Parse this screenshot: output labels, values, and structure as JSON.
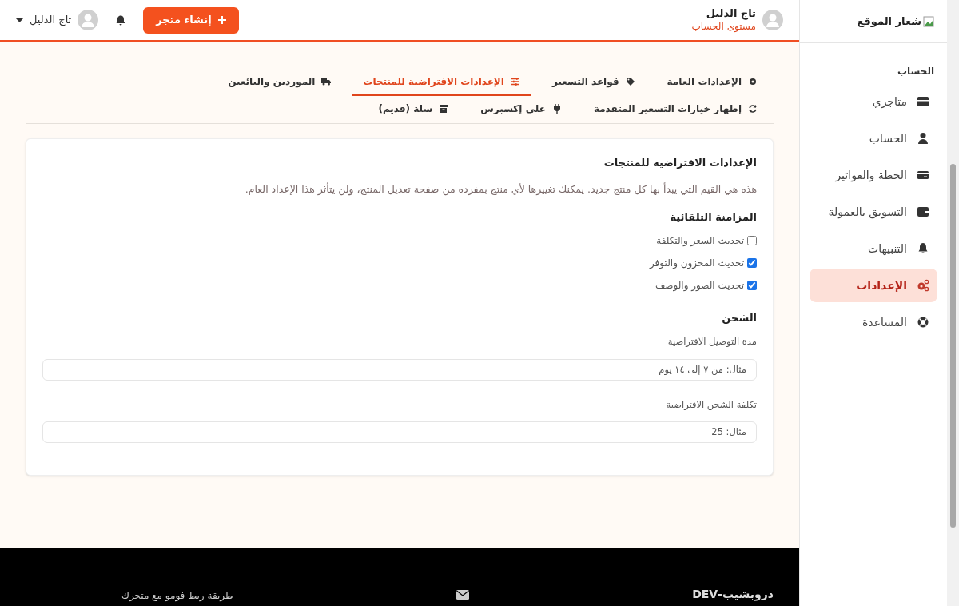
{
  "header": {
    "user_name": "تاج الدليل",
    "account_level": "مستوى الحساب",
    "create_button": "إنشاء متجر",
    "user_menu": "تاج الدليل"
  },
  "sidebar": {
    "logo": "شعار الموقع",
    "section": "الحساب",
    "items": [
      {
        "label": "متاجري",
        "selected": false
      },
      {
        "label": "الحساب",
        "selected": false
      },
      {
        "label": "الخطة والفواتير",
        "selected": false
      },
      {
        "label": "التسويق بالعمولة",
        "selected": false
      },
      {
        "label": "التنبيهات",
        "selected": false
      },
      {
        "label": "الإعدادات",
        "selected": true
      },
      {
        "label": "المساعدة",
        "selected": false
      }
    ]
  },
  "tabs": [
    {
      "label": "الإعدادات العامة",
      "selected": false
    },
    {
      "label": "قواعد التسعير",
      "selected": false
    },
    {
      "label": "الإعدادات الافتراضية للمنتجات",
      "selected": true
    },
    {
      "label": "الموردين والبائعين",
      "selected": false
    },
    {
      "label": "إظهار خيارات التسعير المتقدمة",
      "selected": false
    },
    {
      "label": "علي إكسبرس",
      "selected": false
    },
    {
      "label": "سلة (قديم)",
      "selected": false
    }
  ],
  "card": {
    "title": "الإعدادات الافتراضية للمنتجات",
    "description": "هذه هي القيم التي يبدأ بها كل منتج جديد. يمكنك تغييرها لأي منتج بمفرده من صفحة تعديل المنتج، ولن يتأثر هذا الإعداد العام.",
    "sync_heading": "المزامنة التلقائية",
    "sync_options": [
      {
        "label": "تحديث السعر والتكلفة",
        "checked": false
      },
      {
        "label": "تحديث المخزون والتوفر",
        "checked": true
      },
      {
        "label": "تحديث الصور والوصف",
        "checked": true
      }
    ],
    "shipping_heading": "الشحن",
    "fields": [
      {
        "label": "مدة التوصيل الافتراضية",
        "placeholder": "مثال: من ٧ إلى ١٤ يوم"
      },
      {
        "label": "تكلفة الشحن الافتراضية",
        "placeholder": "مثال: 25"
      }
    ]
  },
  "footer": {
    "brand": "دروبشيب-DEV",
    "link": "طريقة ربط فومو مع متجرك"
  }
}
